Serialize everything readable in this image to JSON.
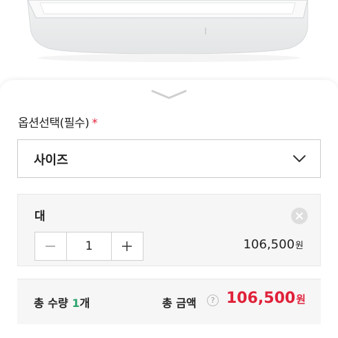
{
  "product_image": {
    "icon": "white-tray-product-photo"
  },
  "sheet": {
    "handle_icon": "chevron-down-icon"
  },
  "option": {
    "label": "옵션선택(필수)",
    "required_mark": "*",
    "select_value": "사이즈",
    "select_icon": "chevron-down-icon"
  },
  "selected_item": {
    "name": "대",
    "quantity": "1",
    "price": "106,500",
    "currency": "원",
    "remove_icon": "close-icon",
    "minus_icon": "minus-icon",
    "plus_icon": "plus-icon"
  },
  "summary": {
    "qty_prefix": "총 수량 ",
    "qty_value": "1",
    "qty_suffix": "개",
    "total_label": "총 금액",
    "help_icon": "?",
    "total_price": "106,500",
    "currency": "원"
  },
  "colors": {
    "accent_price": "#e0213a",
    "quantity_green": "#2aa36b",
    "required_red": "#e5283d"
  }
}
